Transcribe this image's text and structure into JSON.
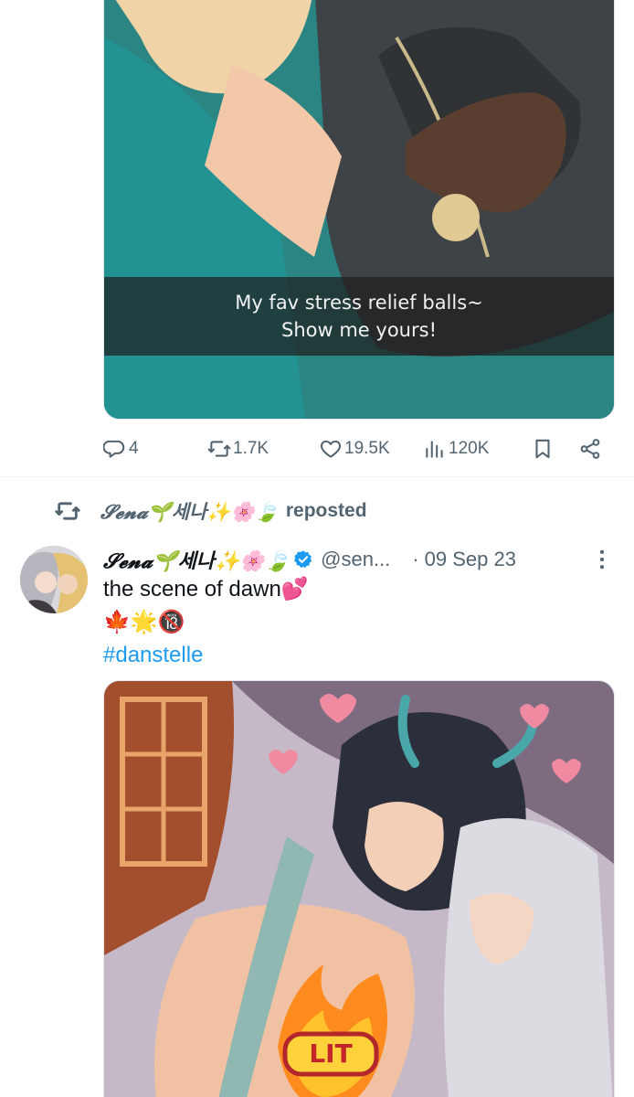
{
  "tweet1": {
    "media": {
      "caption_line1": "My fav stress relief balls~",
      "caption_line2": "Show me yours!"
    },
    "actions": {
      "replies": "4",
      "reposts": "1.7K",
      "likes": "19.5K",
      "views": "120K"
    }
  },
  "tweet2": {
    "repost_by": "𝓢𝓮𝓷𝓪🌱세나✨🌸🍃",
    "repost_suffix": "reposted",
    "author": {
      "display_name": "𝓢𝓮𝓷𝓪🌱세나✨🌸🍃",
      "handle": "@sen...",
      "dot": "·",
      "date": "09 Sep 23"
    },
    "text": "the scene of dawn💕",
    "emoji_line": "🍁🌟🔞",
    "hashtag": "#danstelle",
    "media_badge": "LIT"
  },
  "colors": {
    "text_primary": "#0f1419",
    "text_secondary": "#536471",
    "link": "#1d9bf0",
    "verified": "#1d9bf0",
    "divider": "#eff3f4"
  },
  "icons": [
    "reply-icon",
    "repost-icon",
    "like-icon",
    "views-icon",
    "bookmark-icon",
    "share-icon",
    "verified-badge-icon",
    "more-options-icon"
  ]
}
